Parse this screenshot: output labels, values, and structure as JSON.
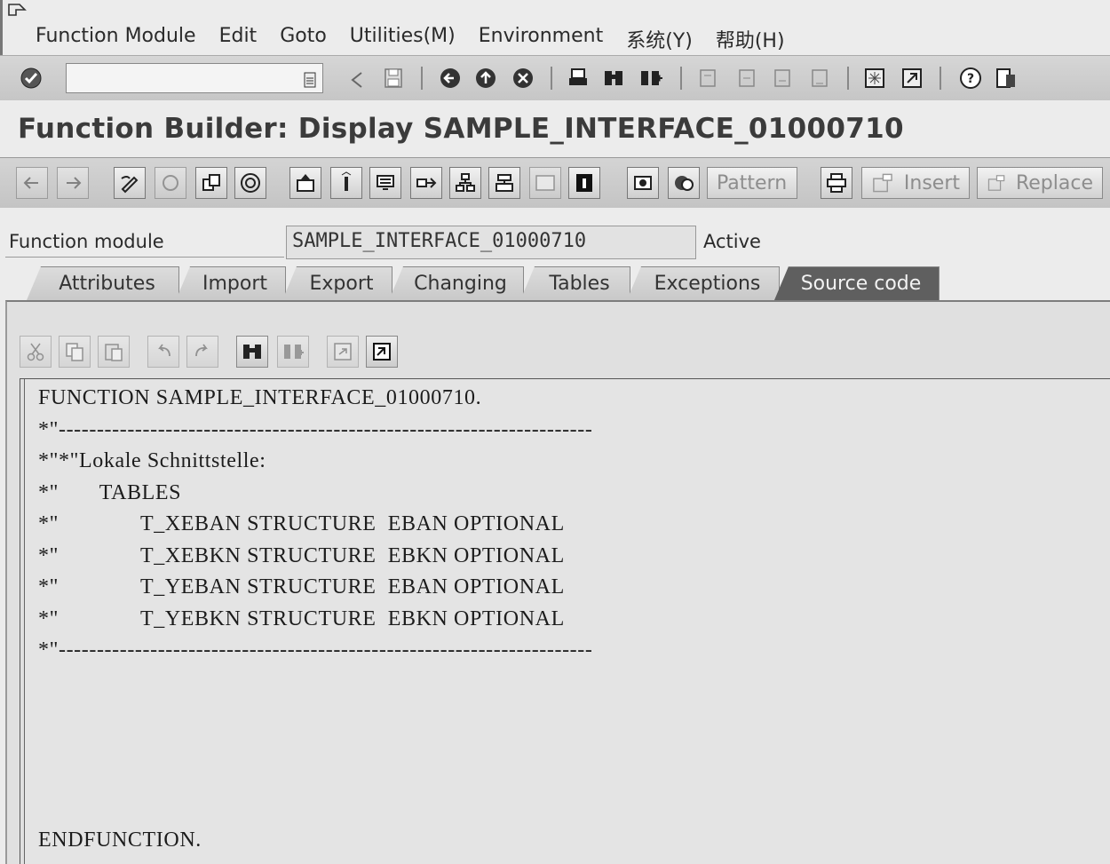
{
  "menubar": {
    "items": [
      "Function Module",
      "Edit",
      "Goto",
      "Utilities(M)",
      "Environment",
      "系统(Y)",
      "帮助(H)"
    ]
  },
  "system_toolbar": {
    "command_field_value": "",
    "icons": [
      "enter-check-icon",
      "command-dropdown-icon",
      "back-arrow-icon",
      "save-icon",
      "back-icon",
      "exit-icon",
      "cancel-icon",
      "print-icon",
      "find-icon",
      "find-next-icon",
      "first-page-icon",
      "previous-page-icon",
      "next-page-icon",
      "last-page-icon",
      "new-session-icon",
      "shortcut-icon",
      "help-icon",
      "layout-menu-icon"
    ]
  },
  "title": "Function Builder: Display SAMPLE_INTERFACE_01000710",
  "app_toolbar": {
    "pattern_label": "Pattern",
    "insert_label": "Insert",
    "replace_label": "Replace"
  },
  "header": {
    "function_module_label": "Function module",
    "function_module_value": "SAMPLE_INTERFACE_01000710",
    "status": "Active"
  },
  "tabs": [
    {
      "label": "Attributes",
      "active": false
    },
    {
      "label": "Import",
      "active": false
    },
    {
      "label": "Export",
      "active": false
    },
    {
      "label": "Changing",
      "active": false
    },
    {
      "label": "Tables",
      "active": false
    },
    {
      "label": "Exceptions",
      "active": false
    },
    {
      "label": "Source code",
      "active": true
    }
  ],
  "editor": {
    "lines": [
      "FUNCTION SAMPLE_INTERFACE_01000710.",
      "*\"----------------------------------------------------------------------",
      "*\"*\"Lokale Schnittstelle:",
      "*\"       TABLES",
      "*\"              T_XEBAN STRUCTURE  EBAN OPTIONAL",
      "*\"              T_XEBKN STRUCTURE  EBKN OPTIONAL",
      "*\"              T_YEBAN STRUCTURE  EBAN OPTIONAL",
      "*\"              T_YEBKN STRUCTURE  EBKN OPTIONAL",
      "*\"----------------------------------------------------------------------",
      "",
      "",
      "",
      "",
      "",
      "ENDFUNCTION."
    ]
  }
}
